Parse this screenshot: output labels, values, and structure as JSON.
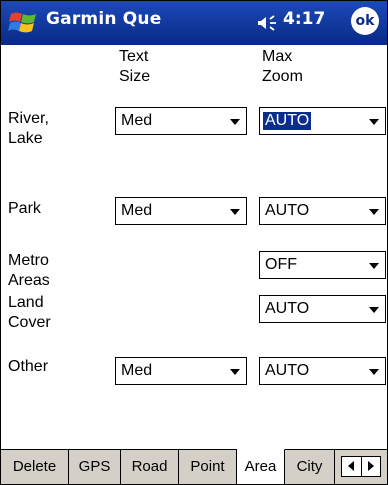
{
  "title_bar": {
    "start_icon": "windows-flag-icon",
    "app_title": "Garmin Que",
    "volume_icon": "speaker-icon",
    "time": "4:17",
    "ok_label": "ok"
  },
  "columns": {
    "text_size_line1": "Text",
    "text_size_line2": "Size",
    "max_zoom_line1": "Max",
    "max_zoom_line2": "Zoom"
  },
  "rows": [
    {
      "label_line1": "River,",
      "label_line2": "Lake",
      "text_size": "Med",
      "max_zoom": "AUTO",
      "max_zoom_selected": true
    },
    {
      "label_line1": "Park",
      "label_line2": "",
      "text_size": "Med",
      "max_zoom": "AUTO"
    },
    {
      "label_line1": "Metro",
      "label_line2": "Areas",
      "text_size": "",
      "max_zoom": "OFF"
    },
    {
      "label_line1": "Land",
      "label_line2": "Cover",
      "text_size": "",
      "max_zoom": "AUTO"
    },
    {
      "label_line1": "Other",
      "label_line2": "",
      "text_size": "Med",
      "max_zoom": "AUTO"
    }
  ],
  "tabs": [
    {
      "label": "Delete"
    },
    {
      "label": "GPS"
    },
    {
      "label": "Road"
    },
    {
      "label": "Point"
    },
    {
      "label": "Area",
      "active": true
    },
    {
      "label": "City"
    }
  ],
  "tab_scroll": {
    "left_icon": "scroll-left-arrow-icon",
    "right_icon": "scroll-right-arrow-icon"
  },
  "colors": {
    "title_bar": "#0b2e8c",
    "selection": "#0b2e8c",
    "tab_bar": "#d4d0c8"
  }
}
